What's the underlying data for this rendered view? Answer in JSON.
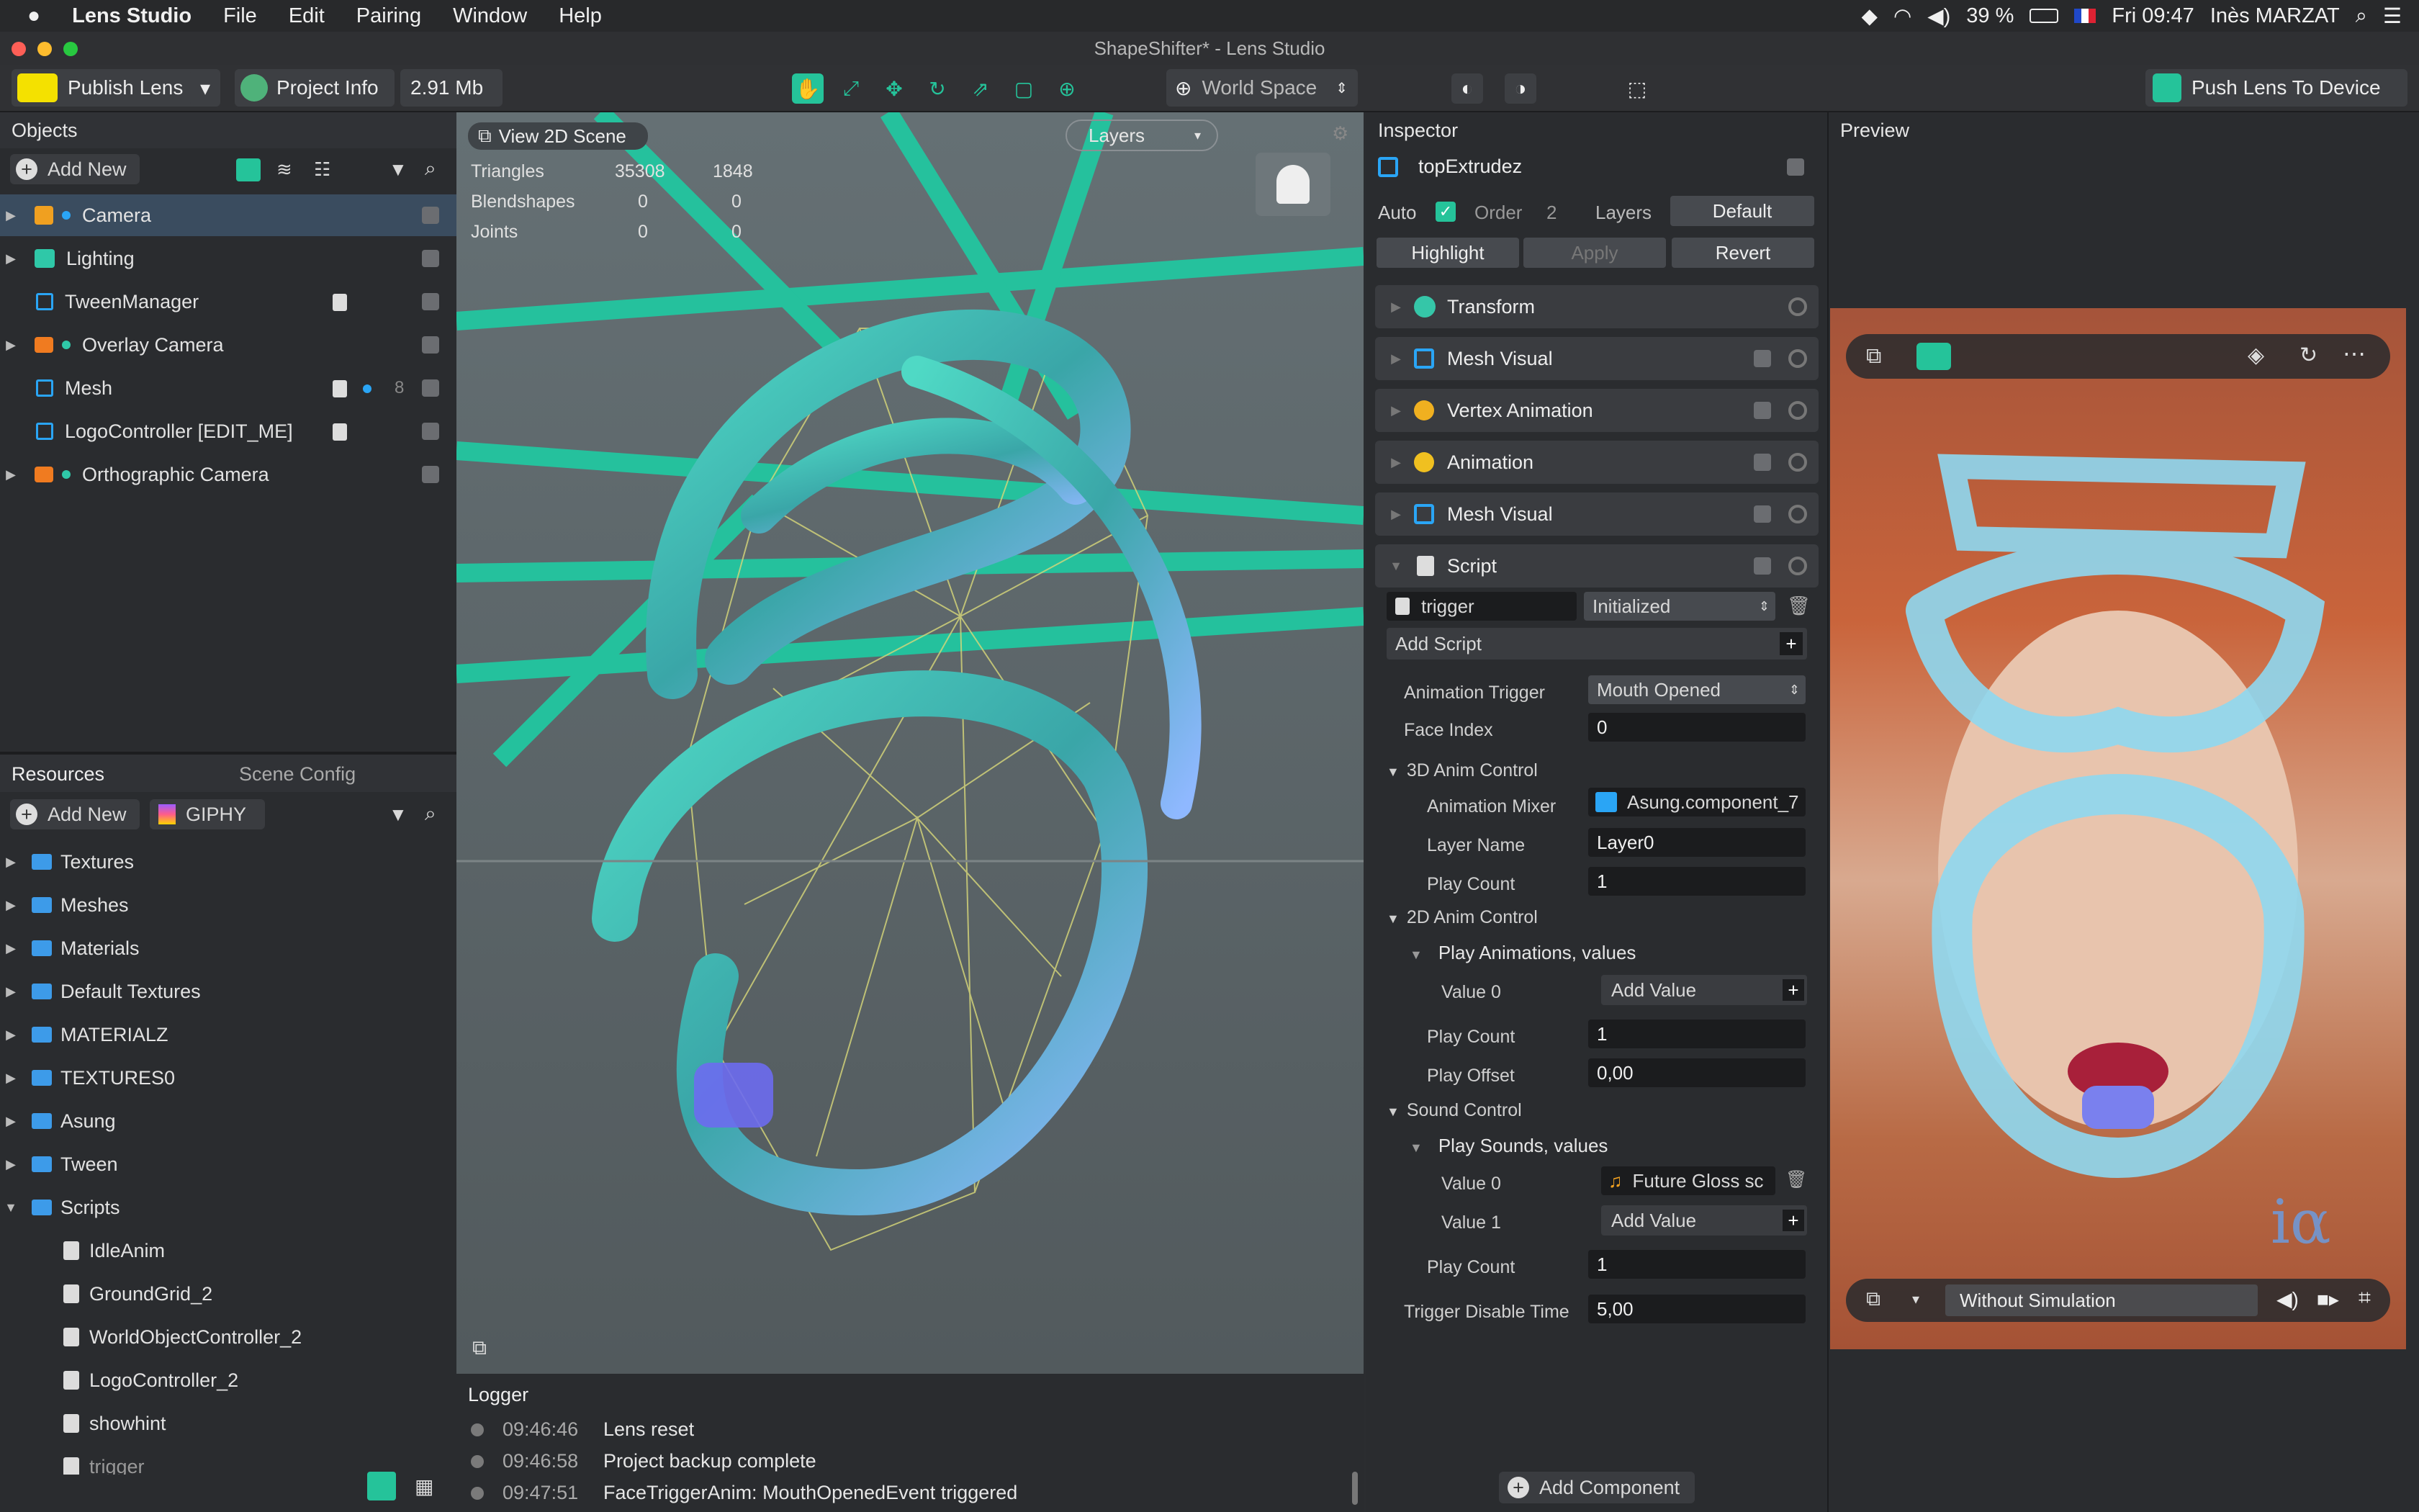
{
  "menubar": {
    "app_name": "Lens Studio",
    "menus": [
      "File",
      "Edit",
      "Pairing",
      "Window",
      "Help"
    ],
    "battery": "39 %",
    "clock": "Fri 09:47",
    "user": "Inès MARZAT"
  },
  "window": {
    "title": "ShapeShifter* - Lens Studio"
  },
  "toolbar": {
    "publish_label": "Publish Lens",
    "project_info_label": "Project Info",
    "size_label": "2.91 Mb",
    "space_label": "World Space",
    "push_label": "Push Lens To Device",
    "accent": "#25c39a"
  },
  "objects": {
    "title": "Objects",
    "add_new": "Add New",
    "items": [
      {
        "label": "Camera",
        "count": ""
      },
      {
        "label": "Lighting",
        "count": ""
      },
      {
        "label": "TweenManager",
        "count": ""
      },
      {
        "label": "Overlay Camera",
        "count": ""
      },
      {
        "label": "Mesh",
        "count": "8"
      },
      {
        "label": "LogoController [EDIT_ME]",
        "count": ""
      },
      {
        "label": "Orthographic Camera",
        "count": ""
      }
    ]
  },
  "resources": {
    "tab_resources": "Resources",
    "tab_scene_config": "Scene Config",
    "add_new": "Add New",
    "giphy": "GIPHY",
    "folders": [
      "Textures",
      "Meshes",
      "Materials",
      "Default Textures",
      "MATERIALZ",
      "TEXTURES0",
      "Asung",
      "Tween",
      "Scripts"
    ],
    "scripts": [
      "IdleAnim",
      "GroundGrid_2",
      "WorldObjectController_2",
      "LogoController_2",
      "showhint",
      "trigger"
    ]
  },
  "scene": {
    "view2d_label": "View 2D Scene",
    "layers_label": "Layers",
    "stats": [
      {
        "label": "Triangles",
        "a": "35308",
        "b": "1848"
      },
      {
        "label": "Blendshapes",
        "a": "0",
        "b": "0"
      },
      {
        "label": "Joints",
        "a": "0",
        "b": "0"
      }
    ]
  },
  "logger": {
    "title": "Logger",
    "entries": [
      {
        "time": "09:46:46",
        "msg": "Lens reset"
      },
      {
        "time": "09:46:58",
        "msg": "Project backup complete"
      },
      {
        "time": "09:47:51",
        "msg": "FaceTriggerAnim: MouthOpenedEvent triggered"
      }
    ]
  },
  "inspector": {
    "title": "Inspector",
    "object_name": "topExtrudez",
    "auto_label": "Auto",
    "order_label": "Order",
    "order_value": "2",
    "layers_label": "Layers",
    "layers_value": "Default",
    "highlight": "Highlight",
    "apply": "Apply",
    "revert": "Revert",
    "components": [
      "Transform",
      "Mesh Visual",
      "Vertex Animation",
      "Animation",
      "Mesh Visual",
      "Script"
    ],
    "script": {
      "file": "trigger",
      "state": "Initialized",
      "add_script": "Add Script",
      "animation_trigger_label": "Animation Trigger",
      "animation_trigger_value": "Mouth Opened",
      "face_index_label": "Face Index",
      "face_index_value": "0",
      "anim3d_title": "3D Anim Control",
      "anim_mixer_label": "Animation Mixer",
      "anim_mixer_value": "Asung.component_7",
      "layer_name_label": "Layer Name",
      "layer_name_value": "Layer0",
      "play_count_label": "Play Count",
      "play_count_3d": "1",
      "anim2d_title": "2D Anim Control",
      "play_anims_label": "Play Animations, values",
      "value0_label": "Value 0",
      "add_value": "Add Value",
      "play_count_2d": "1",
      "play_offset_label": "Play Offset",
      "play_offset_value": "0,00",
      "sound_title": "Sound Control",
      "play_sounds_label": "Play Sounds, values",
      "sound_value0": "Future Gloss sc",
      "value1_label": "Value 1",
      "play_count_sound": "1",
      "trigger_disable_label": "Trigger Disable Time",
      "trigger_disable_value": "5,00"
    },
    "add_component": "Add Component"
  },
  "preview": {
    "title": "Preview",
    "simulation": "Without Simulation"
  }
}
